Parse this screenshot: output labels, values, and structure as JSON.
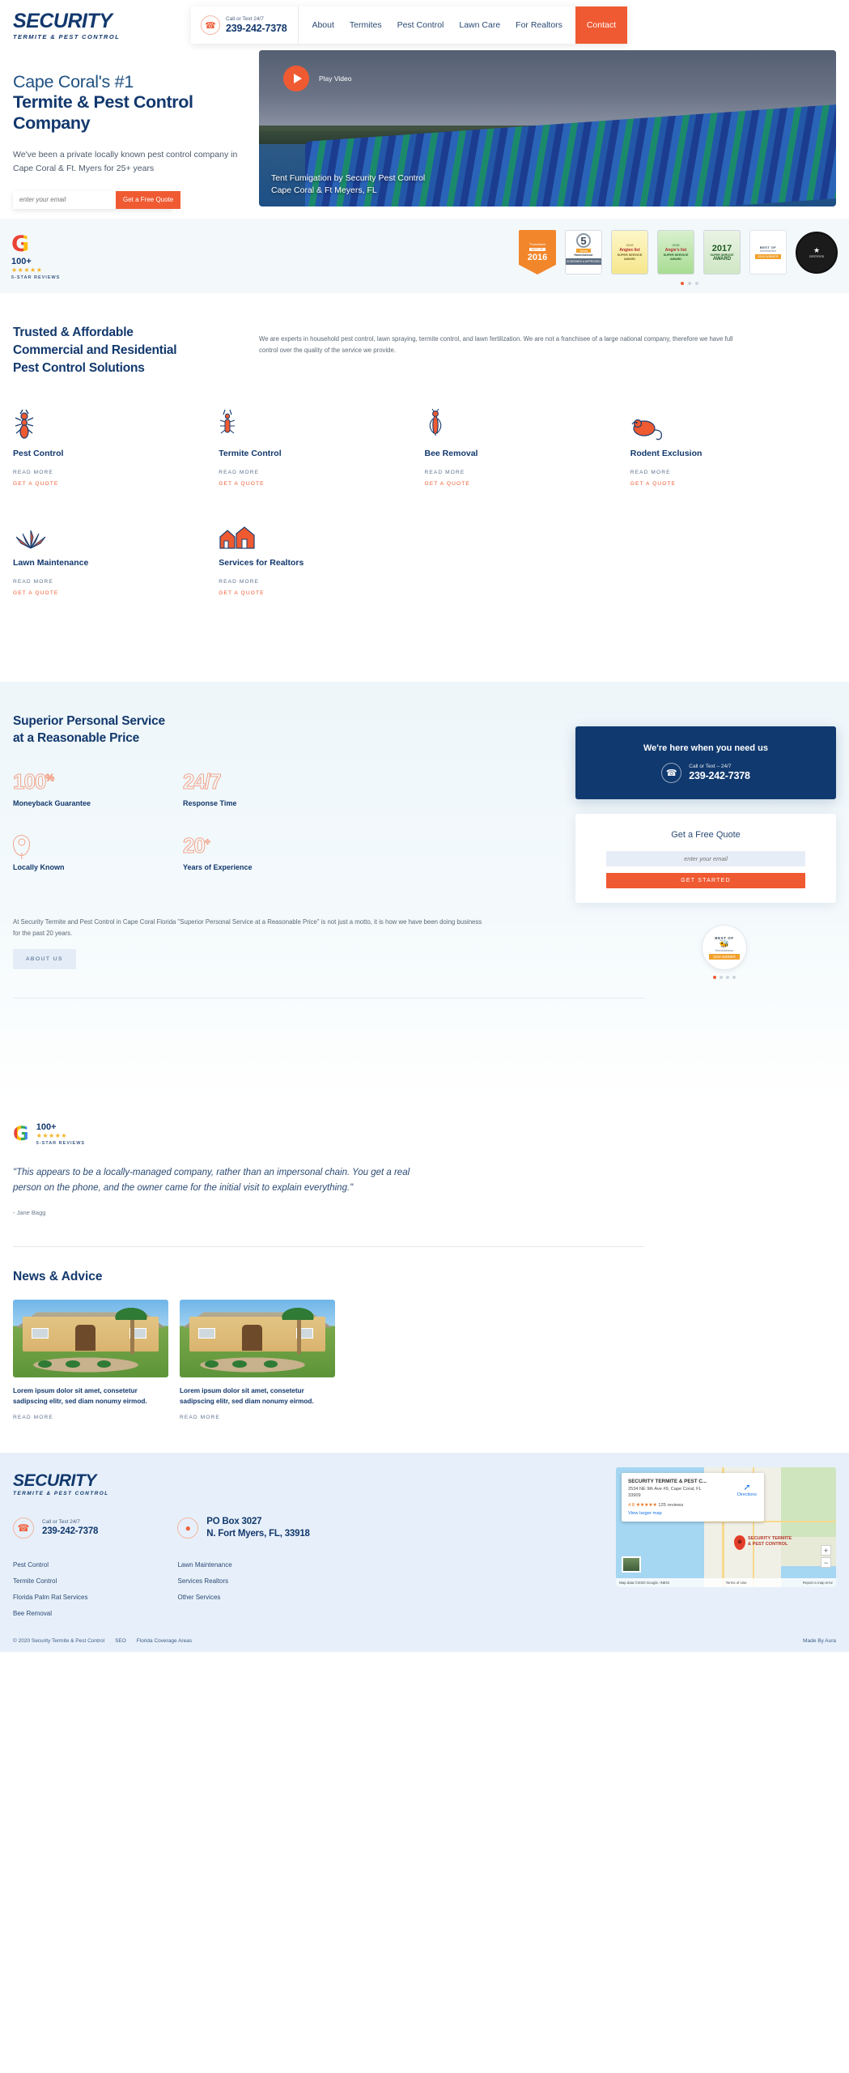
{
  "brand": {
    "name": "SECURITY",
    "tagline": "TERMITE & PEST CONTROL",
    "accent": "#f05a32",
    "navy": "#12386d"
  },
  "header": {
    "phone_label": "Call or Text 24/7",
    "phone": "239-242-7378",
    "nav": [
      {
        "label": "About"
      },
      {
        "label": "Termites"
      },
      {
        "label": "Pest Control"
      },
      {
        "label": "Lawn Care"
      },
      {
        "label": "For Realtors"
      }
    ],
    "contact_label": "Contact"
  },
  "hero": {
    "title_thin": "Cape Coral's #1",
    "title_bold": "Termite & Pest Control Company",
    "paragraph": "We've been a private locally known pest control company in Cape Coral & Ft. Myers for 25+ years",
    "email_placeholder": "enter your email",
    "cta_label": "Get a Free Quote",
    "play_label": "Play Video",
    "video_caption_line1": "Tent Fumigation by Security Pest Control",
    "video_caption_line2": "Cape Coral & Ft Meyers, FL"
  },
  "reviews_bar": {
    "google_count": "100+",
    "google_stars": "★★★★★",
    "google_label": "5-STAR REVIEWS",
    "badges": [
      {
        "name": "thumbtack-best-of-2016",
        "line1": "Thumbtack",
        "line2": "BEST OF",
        "line3": "2016"
      },
      {
        "name": "homeadvisor-5-years",
        "num": "5",
        "year": "Years",
        "brand": "HomeAdvisor",
        "status": "SCREENED & APPROVED"
      },
      {
        "name": "angies-list-super-service-2015",
        "year": "2015",
        "brand": "Angies list",
        "award": "SUPER SERVICE AWARD"
      },
      {
        "name": "angies-list-super-service-2016",
        "year": "2016",
        "brand": "Angie's list",
        "award": "SUPER SERVICE AWARD"
      },
      {
        "name": "angies-list-super-service-2017",
        "yy": "2017",
        "l1": "SUPER SERVICE",
        "l2": "AWARD"
      },
      {
        "name": "best-of-homeadvisor-2016",
        "b1": "BEST OF",
        "b2": "HomeAdvisor",
        "b3": "2016 WINNER"
      },
      {
        "name": "certified-seal",
        "s1": "CERTIFIED",
        "s2": "★"
      }
    ],
    "carousel_dots": 3,
    "active_dot": 0
  },
  "services": {
    "heading_line1": "Trusted & Affordable",
    "heading_line2": "Commercial and Residential",
    "heading_line3": "Pest Control Solutions",
    "description": "We are experts in household pest control, lawn spraying, termite control, and lawn fertilization. We are not a franchisee of a large national company, therefore we have full control over the quality of the service we provide.",
    "read_more_label": "READ MORE",
    "get_quote_label": "GET A QUOTE",
    "items": [
      {
        "title": "Pest Control",
        "icon": "ant-icon"
      },
      {
        "title": "Termite Control",
        "icon": "termite-icon"
      },
      {
        "title": "Bee Removal",
        "icon": "bee-icon"
      },
      {
        "title": "Rodent Exclusion",
        "icon": "rat-icon"
      },
      {
        "title": "Lawn Maintenance",
        "icon": "lawn-icon"
      },
      {
        "title": "Services for Realtors",
        "icon": "house-icon"
      }
    ]
  },
  "superior": {
    "heading_line1": "Superior Personal Service",
    "heading_line2": "at a Reasonable Price",
    "stats": [
      {
        "value": "100",
        "sup": "%",
        "label": "Moneyback Guarantee",
        "icon": ""
      },
      {
        "value": "24/7",
        "sup": "",
        "label": "Response Time",
        "icon": ""
      },
      {
        "value": "",
        "sup": "",
        "label": "Locally Known",
        "icon": "pin-icon"
      },
      {
        "value": "20",
        "sup": "+",
        "label": "Years of Experience",
        "icon": ""
      }
    ],
    "paragraph": "At Security Termite and Pest Control in Cape Coral Florida \"Superior Personal Service at a Reasonable Price\" is not just a motto, it is how we have been doing business for the past 20 years.",
    "about_label": "ABOUT US",
    "cta": {
      "title": "We're here when you need us",
      "phone_label": "Call or Text – 24/7",
      "phone": "239-242-7378"
    },
    "quote": {
      "title": "Get a Free Quote",
      "email_placeholder": "enter your email",
      "button_label": "GET STARTED"
    },
    "award": {
      "a1": "BEST OF",
      "a2": "🐝",
      "a3": "HomeAdvisor",
      "a4": "2016  WINNER"
    }
  },
  "review": {
    "google_count": "100+",
    "google_stars": "★★★★★",
    "google_label": "5-STAR REVIEWS",
    "quote": "\"This appears to be a locally-managed company, rather than an impersonal chain. You get a real person on the phone, and the owner came for the initial visit to explain everything.\"",
    "author": "- Jane Bagg"
  },
  "news": {
    "heading": "News & Advice",
    "read_more_label": "READ MORE",
    "posts": [
      {
        "title": "Lorem ipsum dolor sit amet, consetetur sadipscing elitr, sed diam nonumy eirmod."
      },
      {
        "title": "Lorem ipsum dolor sit amet, consetetur sadipscing elitr, sed diam nonumy eirmod."
      }
    ]
  },
  "footer": {
    "phone_label": "Call or Text 24/7",
    "phone": "239-242-7378",
    "address_line1": "PO Box 3027",
    "address_line2": "N. Fort Myers, FL, 33918",
    "links_col1": [
      {
        "label": "Pest Control"
      },
      {
        "label": "Termite Control"
      },
      {
        "label": "Florida Palm Rat Services"
      },
      {
        "label": "Bee Removal"
      }
    ],
    "links_col2": [
      {
        "label": "Lawn Maintenance"
      },
      {
        "label": "Services Realtors"
      },
      {
        "label": "Other Services"
      }
    ],
    "copyright": "© 2020 Security Termite & Pest Control",
    "bottom_links": [
      {
        "label": "SEO"
      },
      {
        "label": "Florida Coverage Areas"
      }
    ],
    "made_by": "Made By Aura",
    "map": {
      "title": "SECURITY TERMITE & PEST C...",
      "address": "2534 NE 9th Ave #9, Cape Coral, FL 33909",
      "rating": "4.8",
      "stars": "★★★★★",
      "reviews": "125 reviews",
      "view_larger": "View larger map",
      "directions": "Directions",
      "pin_label_line1": "SECURITY TERMITE",
      "pin_label_line2": "& PEST CONTROL",
      "attribution": "Map data ©2020 Google, INEGI",
      "terms": "Terms of Use",
      "report": "Report a map error",
      "zoom_in": "+",
      "zoom_out": "−"
    }
  }
}
